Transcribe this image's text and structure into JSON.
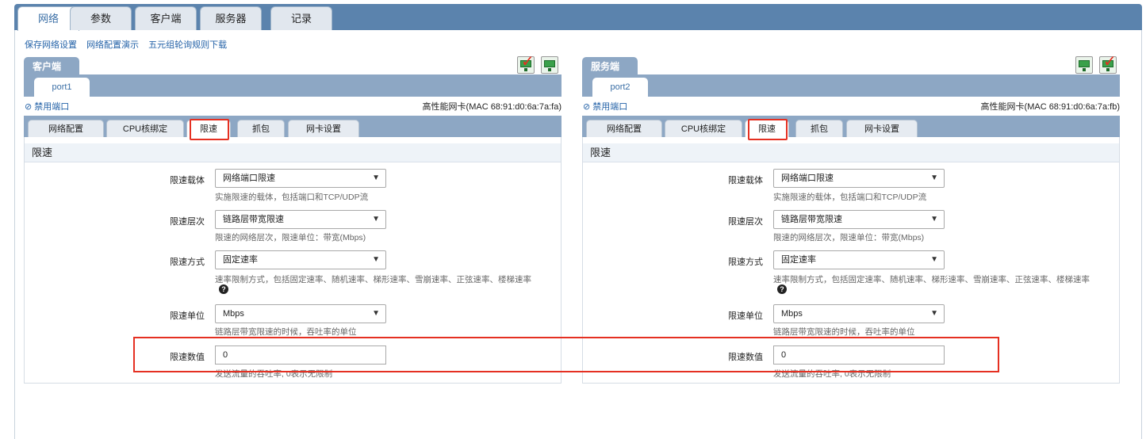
{
  "top_tabs": [
    "网络",
    "参数",
    "客户端",
    "服务器",
    "记录"
  ],
  "links": [
    "保存网络设置",
    "网络配置演示",
    "五元组轮询规则下载"
  ],
  "panels": [
    {
      "role": "客户端",
      "port": "port1",
      "disable_port": "禁用端口",
      "nic": "高性能网卡(MAC 68:91:d0:6a:7a:fa)",
      "sub_tabs": [
        "网络配置",
        "CPU核绑定",
        "限速",
        "抓包",
        "网卡设置"
      ],
      "section_title": "限速",
      "fields": [
        {
          "label": "限速载体",
          "value": "网络端口限速",
          "hint": "实施限速的载体，包括端口和TCP/UDP流"
        },
        {
          "label": "限速层次",
          "value": "链路层带宽限速",
          "hint": "限速的网络层次，限速单位：带宽(Mbps)"
        },
        {
          "label": "限速方式",
          "value": "固定速率",
          "hint": "速率限制方式，包括固定速率、随机速率、梯形速率、雪崩速率、正弦速率、楼梯速率"
        },
        {
          "label": "限速单位",
          "value": "Mbps",
          "hint": "链路层带宽限速的时候，吞吐率的单位"
        },
        {
          "label": "限速数值",
          "value": "0",
          "hint": "发送流量的吞吐率, 0表示无限制"
        }
      ]
    },
    {
      "role": "服务端",
      "port": "port2",
      "disable_port": "禁用端口",
      "nic": "高性能网卡(MAC 68:91:d0:6a:7a:fb)",
      "sub_tabs": [
        "网络配置",
        "CPU核绑定",
        "限速",
        "抓包",
        "网卡设置"
      ],
      "section_title": "限速",
      "fields": [
        {
          "label": "限速载体",
          "value": "网络端口限速",
          "hint": "实施限速的载体，包括端口和TCP/UDP流"
        },
        {
          "label": "限速层次",
          "value": "链路层带宽限速",
          "hint": "限速的网络层次，限速单位：带宽(Mbps)"
        },
        {
          "label": "限速方式",
          "value": "固定速率",
          "hint": "速率限制方式，包括固定速率、随机速率、梯形速率、雪崩速率、正弦速率、楼梯速率"
        },
        {
          "label": "限速单位",
          "value": "Mbps",
          "hint": "链路层带宽限速的时候，吞吐率的单位"
        },
        {
          "label": "限速数值",
          "value": "0",
          "hint": "发送流量的吞吐率, 0表示无限制"
        }
      ]
    }
  ],
  "icons": {
    "monitor": "network-monitor-icon",
    "check": "checkmark-icon",
    "disable": "ban-icon",
    "help": "question-icon"
  },
  "colors": {
    "accent": "#5b83ad",
    "tab_bar": "#8da7c4",
    "highlight": "#e53022",
    "link": "#2563a8"
  }
}
